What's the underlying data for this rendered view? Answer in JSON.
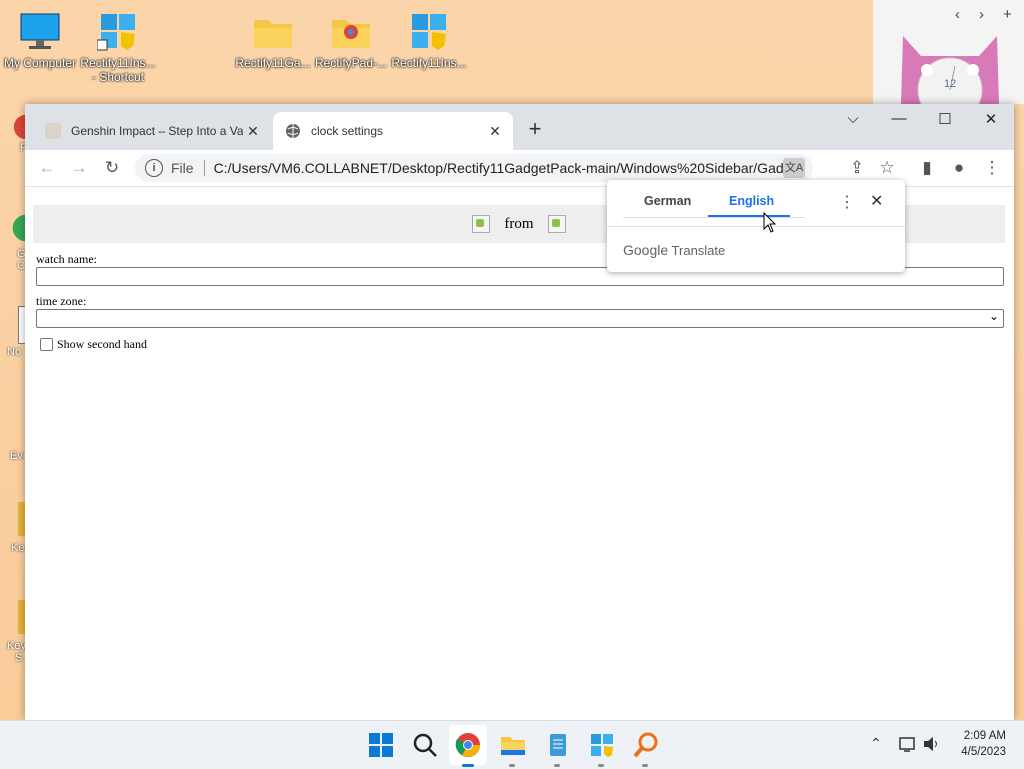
{
  "desktop": {
    "icons": [
      {
        "label": "My Computer"
      },
      {
        "label": "Rectify11Ins... - Shortcut"
      },
      {
        "label": "Rectify11Ga..."
      },
      {
        "label": "RectifyPad-..."
      },
      {
        "label": "Rectify11Ins..."
      }
    ],
    "left_partial_labels": [
      "F",
      "G",
      "C",
      "No",
      "Eve",
      "Ke",
      "Key",
      "S"
    ]
  },
  "gadget": {
    "clock_number": "12"
  },
  "browser": {
    "tabs": [
      {
        "title": "Genshin Impact – Step Into a Vas",
        "active": false
      },
      {
        "title": "clock settings",
        "active": true
      }
    ],
    "new_tab_label": "+",
    "address": {
      "scheme": "File",
      "url": "C:/Users/VM6.COLLABNET/Desktop/Rectify11GadgetPack-main/Windows%20Sidebar/Gadgets/..."
    }
  },
  "page": {
    "header_text": "from",
    "watch_name_label": "watch name:",
    "watch_name_value": "",
    "time_zone_label": "time zone:",
    "time_zone_value": "",
    "show_second_hand_label": "Show second hand",
    "show_second_hand_checked": false
  },
  "translate_popup": {
    "languages": [
      "German",
      "English"
    ],
    "selected": "English",
    "brand": "Google",
    "product": "Translate"
  },
  "taskbar": {
    "time": "2:09 AM",
    "date": "4/5/2023"
  },
  "colors": {
    "accent": "#1a73e8",
    "taskbar_bg": "#eef1f6",
    "tabbar_bg": "#dee1e6"
  }
}
